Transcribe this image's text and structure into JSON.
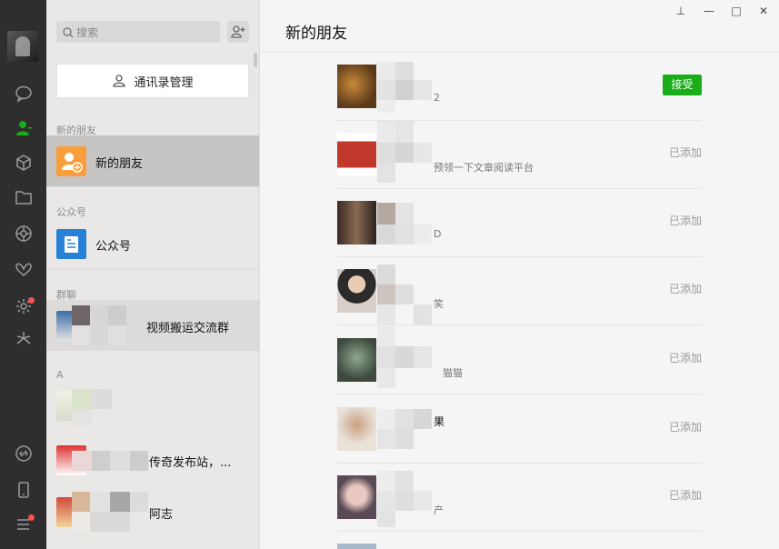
{
  "search": {
    "placeholder": "搜索"
  },
  "contacts_management": {
    "label": "通讯录管理"
  },
  "sections": {
    "new_friends": "新的朋友",
    "official": "公众号",
    "groups": "群聊",
    "letter_a": "A"
  },
  "list": {
    "new_friends_label": "新的朋友",
    "official_label": "公众号",
    "group_name": "视频搬运交流群",
    "contact_1": "",
    "contact_2": "传奇发布站，...",
    "contact_3": "阿志"
  },
  "main": {
    "title": "新的朋友",
    "requests": [
      {
        "nick": "",
        "message": "2",
        "status": "接受",
        "is_button": true
      },
      {
        "nick": "",
        "message": "预领一下文章阅读平台",
        "status": "已添加"
      },
      {
        "nick": "",
        "message": "D",
        "status": "已添加"
      },
      {
        "nick": "",
        "message": "笑",
        "status": "已添加"
      },
      {
        "nick": "",
        "message": "猫猫",
        "status": "已添加"
      },
      {
        "nick": "果",
        "message": "",
        "status": "已添加"
      },
      {
        "nick": "",
        "message": "产",
        "status": "已添加"
      }
    ]
  },
  "window_controls": {
    "pin": "⊥",
    "minimize": "—",
    "maximize": "□",
    "close": "✕"
  },
  "colors": {
    "accent": "#1aad19",
    "rail": "#2e2e2e",
    "badge": "#fa5151"
  },
  "icons": [
    "chat-icon",
    "contacts-icon",
    "cube-icon",
    "folder-icon",
    "moments-icon",
    "butterfly-icon",
    "settings-icon",
    "mini-program-icon",
    "link-icon",
    "phone-icon",
    "menu-icon"
  ]
}
